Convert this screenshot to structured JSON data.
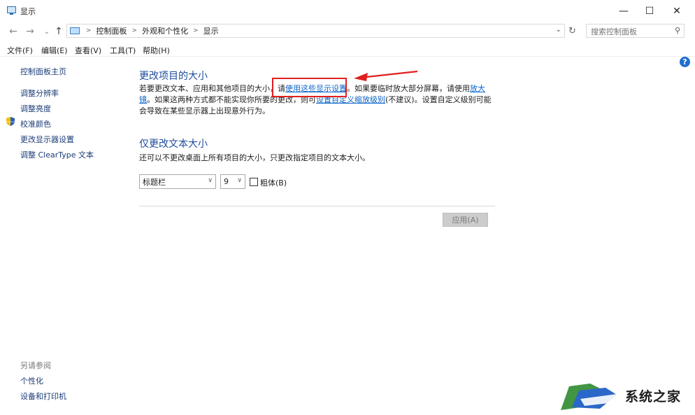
{
  "window": {
    "title": "显示",
    "minimize": "—",
    "maximize": "☐",
    "close": "✕"
  },
  "nav": {
    "back": "←",
    "forward": "→",
    "recent": "⌄",
    "up": "↑"
  },
  "breadcrumb": [
    "控制面板",
    "外观和个性化",
    "显示"
  ],
  "search": {
    "placeholder": "搜索控制面板"
  },
  "menu": [
    "文件(F)",
    "编辑(E)",
    "查看(V)",
    "工具(T)",
    "帮助(H)"
  ],
  "sidebar": {
    "home": "控制面板主页",
    "items": [
      "调整分辨率",
      "调整亮度",
      "校准颜色",
      "更改显示器设置",
      "调整 ClearType 文本"
    ],
    "see_also_title": "另请参阅",
    "see_also": [
      "个性化",
      "设备和打印机"
    ]
  },
  "main": {
    "section1_title": "更改项目的大小",
    "para1_a": "若要更改文本、应用和其他项目的大小，请",
    "para1_link1": "使用这些显示设置",
    "para1_b": "。如果要临时放大部分屏幕，请使用",
    "para1_link2": "放大镜",
    "para1_c": "。如果这两种方式都不能实现你所要的更改，则可",
    "para1_link3": "设置自定义缩放级别",
    "para1_d": "(不建议)。设置自定义级别可能会导致在某些显示器上出现意外行为。",
    "section2_title": "仅更改文本大小",
    "para2": "还可以不更改桌面上所有项目的大小，只更改指定项目的文本大小。",
    "item_select": "标题栏",
    "size_select": "9",
    "bold_label": "粗体(B)",
    "bold_checked": false,
    "apply_label": "应用(A)"
  },
  "help_icon": "?",
  "watermark": {
    "text": "系统之家"
  },
  "colors": {
    "heading": "#1e4b9c",
    "link": "#0a64c8",
    "annotation": "#e02020"
  }
}
